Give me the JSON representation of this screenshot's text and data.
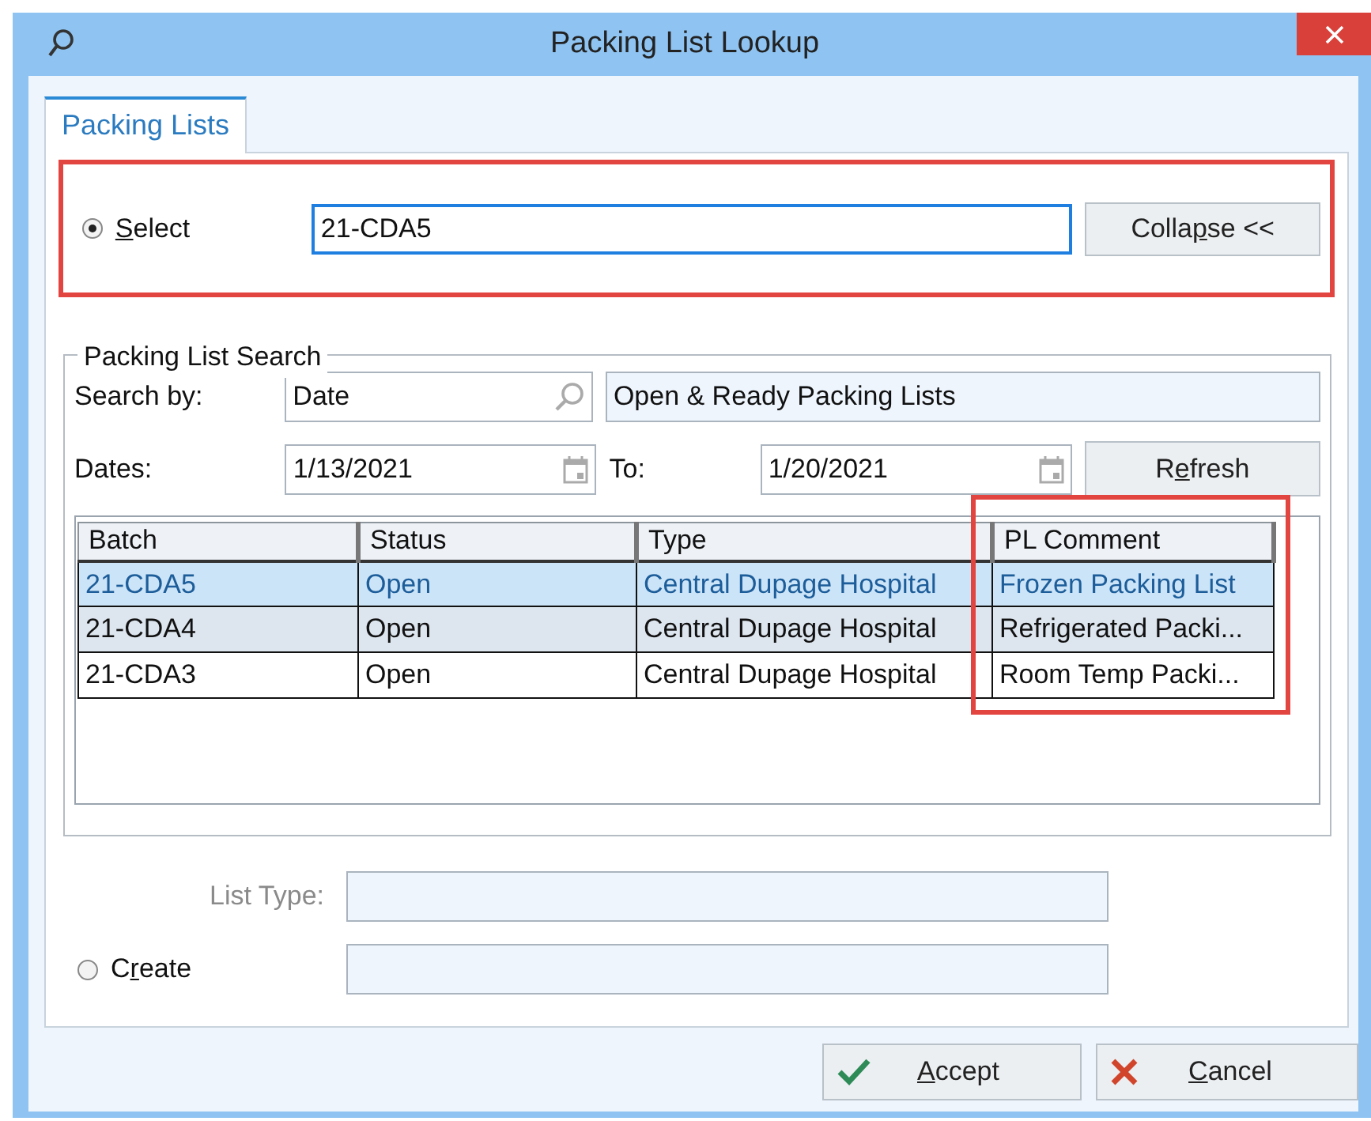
{
  "window": {
    "title": "Packing List Lookup"
  },
  "tabs": [
    {
      "label": "Packing Lists",
      "selected": true
    }
  ],
  "select": {
    "mnemonic": "S",
    "label_after": "elect",
    "selected": true,
    "value": "21-CDA5",
    "highlighted": true,
    "button": {
      "label_before": "Colla",
      "mnemonic": "p",
      "label_after": "se <<"
    }
  },
  "search": {
    "legend": "Packing List Search",
    "search_by_label": "Search by:",
    "search_by_value": "Date",
    "filter_value": "Open & Ready Packing Lists",
    "dates_label": "Dates:",
    "from": "1/13/2021",
    "to_label": "To:",
    "to": "1/20/2021",
    "refresh": {
      "label_before": "R",
      "mnemonic": "e",
      "label_after": "fresh"
    }
  },
  "table": {
    "columns": [
      {
        "label": "Batch",
        "highlighted": false
      },
      {
        "label": "Status",
        "highlighted": false
      },
      {
        "label": "Type",
        "highlighted": false
      },
      {
        "label": "PL Comment",
        "highlighted": true
      }
    ],
    "rows": [
      {
        "selected": true,
        "cells": [
          "21-CDA5",
          "Open",
          "Central Dupage Hospital",
          "Frozen Packing List"
        ]
      },
      {
        "selected": false,
        "shaded": true,
        "cells": [
          "21-CDA4",
          "Open",
          "Central Dupage Hospital",
          "Refrigerated Packi..."
        ]
      },
      {
        "selected": false,
        "shaded": false,
        "cells": [
          "21-CDA3",
          "Open",
          "Central Dupage Hospital",
          "Room Temp Packi..."
        ]
      }
    ]
  },
  "create": {
    "list_type_label": "List Type:",
    "list_type_disabled": true,
    "label_before": "C",
    "mnemonic": "r",
    "label_after": "eate",
    "selected": false
  },
  "buttons": [
    {
      "kind": "accept",
      "mnemonic": "A",
      "label_after": "ccept"
    },
    {
      "kind": "cancel",
      "mnemonic": "C",
      "label_after": "ancel"
    }
  ]
}
